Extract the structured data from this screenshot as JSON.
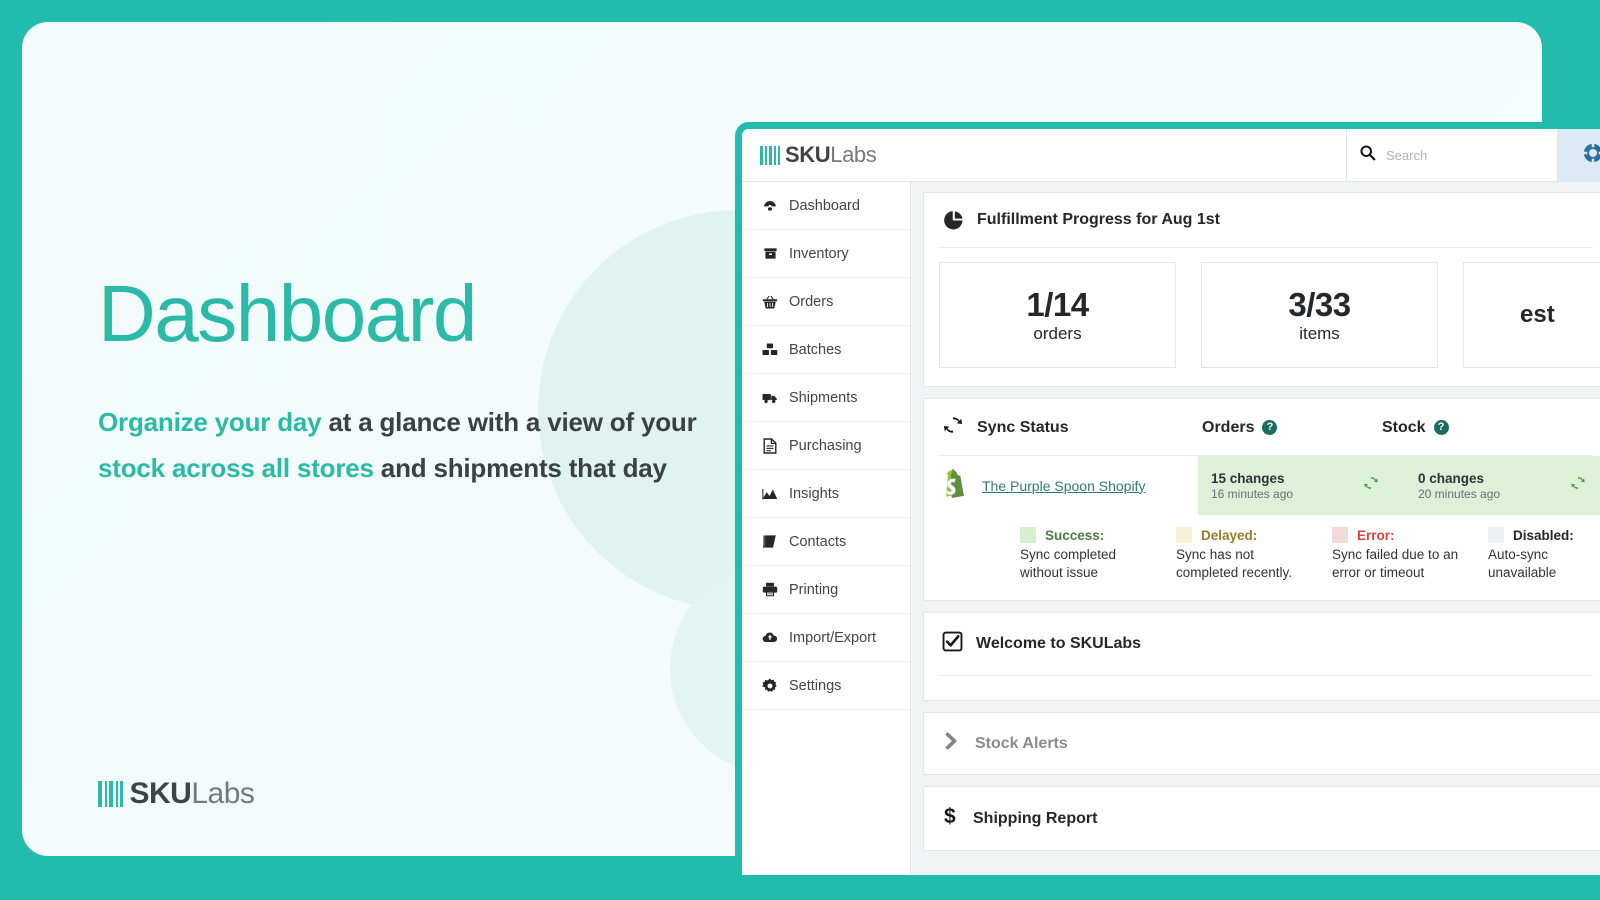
{
  "hero": {
    "title": "Dashboard",
    "sub_a": "Organize your day",
    "sub_b": " at a glance with a view of your ",
    "sub_c": "stock across all stores",
    "sub_d": " and shipments that day",
    "logo_sku": "SKU",
    "logo_labs": "Labs",
    "accent_color": "#2bb9a8"
  },
  "app": {
    "logo_sku": "SKU",
    "logo_labs": "Labs",
    "search": {
      "value": "",
      "placeholder": "Search",
      "clear_label": "×"
    },
    "help_icon": "lifebuoy-icon",
    "sidebar": [
      {
        "label": "Dashboard",
        "icon": "dashboard-gauge-icon"
      },
      {
        "label": "Inventory",
        "icon": "box-icon"
      },
      {
        "label": "Orders",
        "icon": "basket-icon"
      },
      {
        "label": "Batches",
        "icon": "boxes-icon"
      },
      {
        "label": "Shipments",
        "icon": "truck-icon"
      },
      {
        "label": "Purchasing",
        "icon": "document-icon"
      },
      {
        "label": "Insights",
        "icon": "chart-area-icon"
      },
      {
        "label": "Contacts",
        "icon": "address-book-icon"
      },
      {
        "label": "Printing",
        "icon": "printer-icon"
      },
      {
        "label": "Import/Export",
        "icon": "cloud-upload-icon"
      },
      {
        "label": "Settings",
        "icon": "gear-icon"
      }
    ],
    "fulfillment": {
      "title": "Fulfillment Progress for Aug 1st",
      "icon": "pie-chart-icon",
      "stats": [
        {
          "value": "1/14",
          "label": "orders"
        },
        {
          "value": "3/33",
          "label": "items"
        },
        {
          "value": "est",
          "label": ""
        }
      ]
    },
    "sync": {
      "title": "Sync Status",
      "icon": "sync-refresh-icon",
      "col_orders": "Orders",
      "col_stock": "Stock",
      "help_glyph": "?",
      "store": {
        "name": "The Purple Spoon Shopify",
        "icon": "shopify-icon",
        "orders": {
          "changes": "15 changes",
          "ago": "16 minutes ago"
        },
        "stock": {
          "changes": "0 changes",
          "ago": "20 minutes ago"
        }
      },
      "legend": [
        {
          "term": "Success:",
          "desc": "Sync completed without issue",
          "swatch": "#d9edd1",
          "color": "#4b7d3c"
        },
        {
          "term": "Delayed:",
          "desc": "Sync has not completed recently.",
          "swatch": "#f7f1d6",
          "color": "#9a7b2a"
        },
        {
          "term": "Error:",
          "desc": "Sync failed due to an error or timeout",
          "swatch": "#f4d9d9",
          "color": "#d9453c"
        },
        {
          "term": "Disabled:",
          "desc": "Auto-sync unavailable",
          "swatch": "#eef0f1",
          "color": "#23282c"
        }
      ]
    },
    "welcome": {
      "title": "Welcome to SKULabs",
      "icon": "checkbox-checked-icon"
    },
    "stock_alerts": {
      "title": "Stock Alerts",
      "icon": "chevron-right-icon"
    },
    "shipping_report": {
      "title": "Shipping Report",
      "icon": "dollar-icon"
    }
  }
}
